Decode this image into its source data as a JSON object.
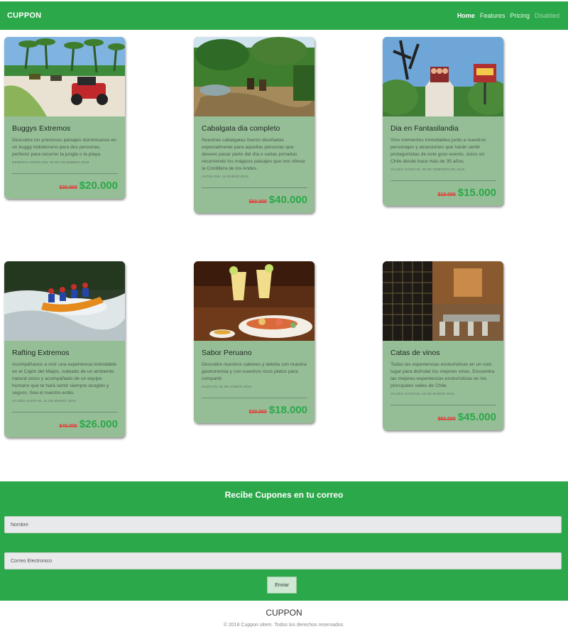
{
  "navbar": {
    "brand": "CUPPON",
    "links": [
      {
        "label": "Home"
      },
      {
        "label": "Features"
      },
      {
        "label": "Pricing"
      },
      {
        "label": "Disabled"
      }
    ]
  },
  "cards": [
    {
      "title": "Buggys Extremos",
      "text": "Descubre los preciosos paisajes dominicanos en un buggy todoterreno para dos personas, perfecto para recorrer la jungla o la playa.",
      "date": "RESERVA ANTES DEL 30 DE DICIEMBRE 2018",
      "old_price": "$30.000",
      "new_price": "$20.000"
    },
    {
      "title": "Cabalgata dia completo",
      "text": "Nuestras cabalgatas fueron diseñadas especialmente para aquellas personas que deseen pasar parte del día o varias jornadas recorriendo los mágicos paisajes que nos ofrece la Cordillera de los Andes.",
      "date": "ANTES DEL 15 ENERO 2019",
      "old_price": "$60.000",
      "new_price": "$40.000"
    },
    {
      "title": "Dia en Fantasilandia",
      "text": "Vive momentos inolvidables junto a nuestros personajes y atracciones que harán sentir protagonistas de este gran evento, único en Chile desde hace más de 35 años.",
      "date": "VÁLIDO HASTA EL 28 DE FEBRERO DE 2019",
      "old_price": "$18.000",
      "new_price": "$15.000"
    },
    {
      "title": "Rafting Extremos",
      "text": "Acompáñanos a vivir una experiencia inolvidable en el Cajón del Maipo, rodeado de un ambiente natural único y acompañado de un equipo humano que te hará sentir siempre acogido y seguro. Sea el nuestro estilo.",
      "date": "VÁLIDO HASTA EL 31 DE MARZO 2019",
      "old_price": "$40.000",
      "new_price": "$26.000"
    },
    {
      "title": "Sabor Peruano",
      "text": "Descubre nuestros sabores y deleita con nuestra gastronomía y con nuestros ricos platos para compartir.",
      "date": "HASTA EL 20 DE ENERO 2019",
      "old_price": "$30.000",
      "new_price": "$18.000"
    },
    {
      "title": "Catas de vinos",
      "text": "Todas las experiencias enoturísticas en un solo lugar para disfrutar los mejores vinos. Encuentra las mejores experiencias enoturísticas en los principales valles de Chile.",
      "date": "VÁLIDO HASTA EL 15 DE MARZO 2019",
      "old_price": "$60.000",
      "new_price": "$45.000"
    }
  ],
  "newsletter": {
    "title": "Recibe Cupones en tu correo",
    "name_placeholder": "Nombre",
    "email_placeholder": "Correo Electronico",
    "button_label": "Enviar"
  },
  "footer": {
    "brand": "CUPPON",
    "copyright": "© 2018 Cuppon sitem. Todos los derechos reservados."
  },
  "colors": {
    "primary": "#2ba849",
    "card_bg": "#95be97",
    "old_price": "#e53935"
  }
}
